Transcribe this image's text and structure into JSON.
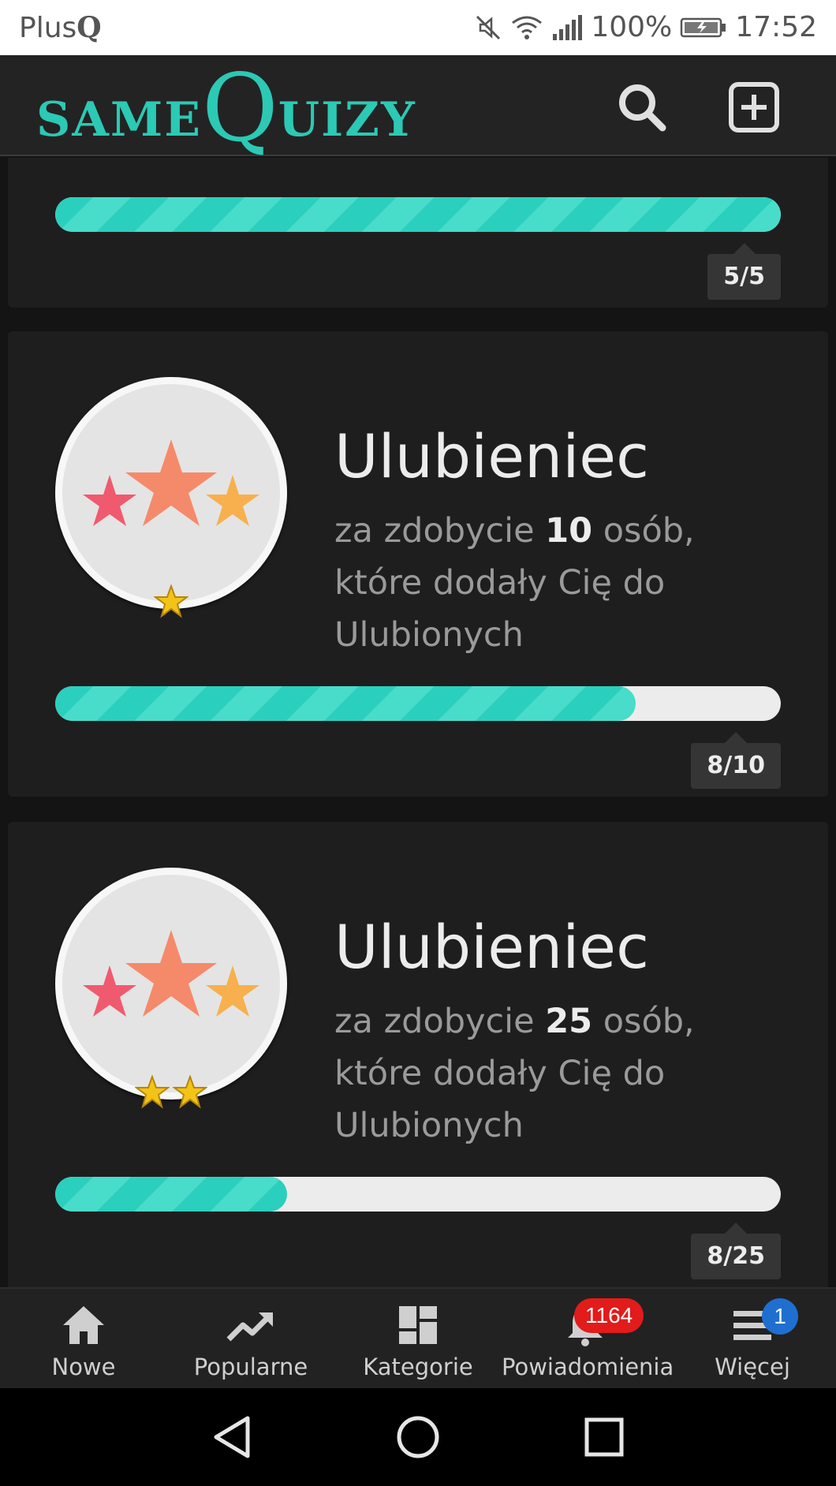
{
  "status_bar": {
    "carrier": "Plus",
    "carrier_logo": "Q",
    "battery": "100%",
    "time": "17:52"
  },
  "header": {
    "logo_same": "SAME",
    "logo_q": "Q",
    "logo_uizy": "UIZY",
    "search_icon": "search-icon",
    "add_icon": "plus-square-icon",
    "accent_color": "#2cc9b4"
  },
  "achievements": [
    {
      "count_label": "5/5",
      "progress": 1.0
    },
    {
      "title": "Ulubieniec",
      "desc_prefix": "za zdobycie ",
      "desc_number": "10",
      "desc_suffix": " osób, które dodały Cię do Ulubionych",
      "count_label": "8/10",
      "progress": 0.8,
      "level_stars": 1
    },
    {
      "title": "Ulubieniec",
      "desc_prefix": "za zdobycie ",
      "desc_number": "25",
      "desc_suffix": " osób, które dodały Cię do Ulubionych",
      "count_label": "8/25",
      "progress": 0.32,
      "level_stars": 2
    }
  ],
  "bottom_nav": {
    "items": [
      {
        "label": "Nowe",
        "icon": "home-icon"
      },
      {
        "label": "Popularne",
        "icon": "trending-icon"
      },
      {
        "label": "Kategorie",
        "icon": "grid-icon"
      },
      {
        "label": "Powiadomienia",
        "icon": "bell-icon",
        "badge": "1164"
      },
      {
        "label": "Więcej",
        "icon": "menu-icon",
        "badge": "1"
      }
    ]
  },
  "colors": {
    "progress_fill": "#2ad0bd",
    "notification_badge": "#e21b1b",
    "more_badge": "#1f6fd1"
  }
}
